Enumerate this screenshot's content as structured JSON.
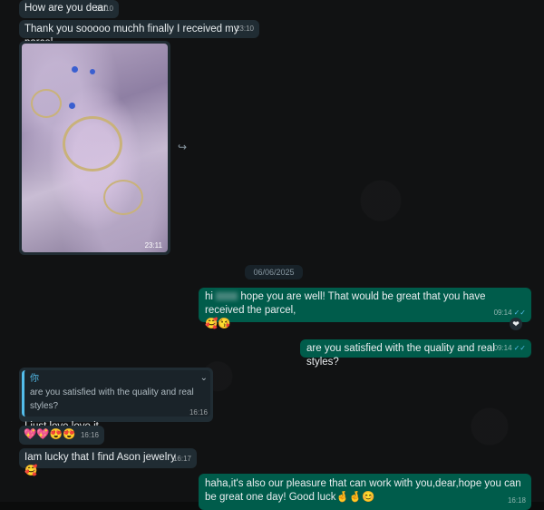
{
  "messages": {
    "m1": {
      "text": "How are you dear",
      "time": "23:10"
    },
    "m2": {
      "text": "Thank you sooooo muchh finally I received my parcel",
      "time": "23:10"
    },
    "photo": {
      "time": "23:11"
    },
    "date_divider": "06/06/2025",
    "m3": {
      "prefix": "hi",
      "text": "hope you are well! That would be great that you have received the parcel,",
      "emoji": "🥰😘",
      "time": "09:14"
    },
    "m4": {
      "text": "are you satisfied with the quality and real styles?",
      "time": "09:14"
    },
    "m5": {
      "reply_name": "你",
      "reply_text": "are you satisfied with the quality and real styles?",
      "text": "I just love love it",
      "time": "16:16"
    },
    "m6": {
      "emoji": "💖💖😍😍",
      "time": "16:16"
    },
    "m7": {
      "text": "Iam lucky that I find Ason jewelry 🥰",
      "time": "16:17"
    },
    "m8": {
      "text": "haha,it's also our pleasure that can work with you,dear,hope you can be great one day! Good luck🤞🤞😊",
      "time": "16:18"
    }
  },
  "icons": {
    "forward": "forward-icon",
    "read": "double-check-icon",
    "reaction": "heart-reaction-icon",
    "chevron": "chevron-down-icon"
  },
  "colors": {
    "incoming": "#202c33",
    "outgoing": "#005c4b",
    "ticks": "#53bdeb"
  }
}
